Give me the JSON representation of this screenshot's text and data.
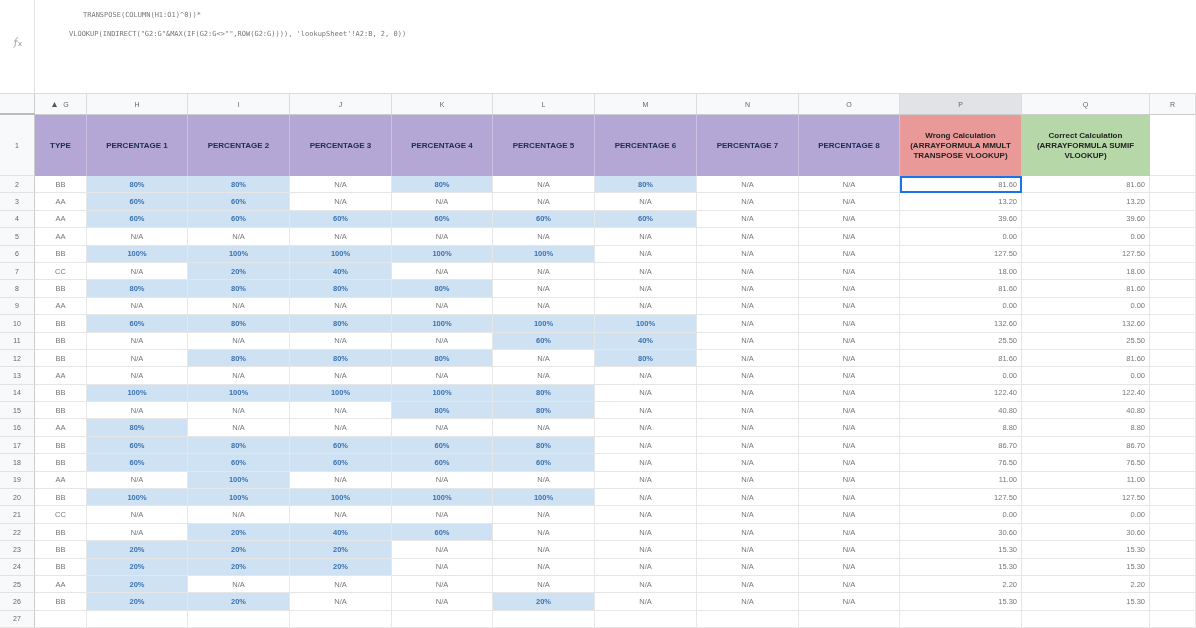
{
  "formula_bar": {
    "lines": [
      "TRANSPOSE(COLUMN(H1:O1)^0))*",
      "VLOOKUP(INDIRECT(\"G2:G\"&MAX(IF(G2:G<>\"\",ROW(G2:G)))), 'lookupSheet'!A2:B, 2, 0))"
    ]
  },
  "column_letters": [
    {
      "label": "G",
      "selected": false
    },
    {
      "label": "H",
      "selected": false
    },
    {
      "label": "I",
      "selected": false
    },
    {
      "label": "J",
      "selected": false
    },
    {
      "label": "K",
      "selected": false
    },
    {
      "label": "L",
      "selected": false
    },
    {
      "label": "M",
      "selected": false
    },
    {
      "label": "N",
      "selected": false
    },
    {
      "label": "O",
      "selected": false
    },
    {
      "label": "P",
      "selected": true
    },
    {
      "label": "Q",
      "selected": false
    },
    {
      "label": "R",
      "selected": false
    }
  ],
  "header_row": {
    "number": "1",
    "cells": [
      {
        "text": "TYPE",
        "color": "#b4a7d6"
      },
      {
        "text": "PERCENTAGE 1",
        "color": "#b4a7d6"
      },
      {
        "text": "PERCENTAGE 2",
        "color": "#b4a7d6"
      },
      {
        "text": "PERCENTAGE 3",
        "color": "#b4a7d6"
      },
      {
        "text": "PERCENTAGE 4",
        "color": "#b4a7d6"
      },
      {
        "text": "PERCENTAGE 5",
        "color": "#b4a7d6"
      },
      {
        "text": "PERCENTAGE 6",
        "color": "#b4a7d6"
      },
      {
        "text": "PERCENTAGE 7",
        "color": "#b4a7d6"
      },
      {
        "text": "PERCENTAGE 8",
        "color": "#b4a7d6"
      },
      {
        "text": "Wrong Calculation (ARRAYFORMULA MMULT TRANSPOSE VLOOKUP)",
        "color": "#ea9999"
      },
      {
        "text": "Correct Calculation (ARRAYFORMULA SUMIF VLOOKUP)",
        "color": "#b6d7a8"
      }
    ]
  },
  "rows": [
    {
      "number": "2",
      "type": "BB",
      "percentages": [
        "80%",
        "80%",
        "N/A",
        "80%",
        "N/A",
        "80%",
        "N/A",
        "N/A"
      ],
      "highlighted": [
        true,
        true,
        false,
        true,
        false,
        true,
        false,
        false
      ],
      "wrong": "81.60",
      "correct": "81.60",
      "wrong_selected": true
    },
    {
      "number": "3",
      "type": "AA",
      "percentages": [
        "60%",
        "60%",
        "N/A",
        "N/A",
        "N/A",
        "N/A",
        "N/A",
        "N/A"
      ],
      "highlighted": [
        true,
        true,
        false,
        false,
        false,
        false,
        false,
        false
      ],
      "wrong": "13.20",
      "correct": "13.20",
      "wrong_selected": false
    },
    {
      "number": "4",
      "type": "AA",
      "percentages": [
        "60%",
        "60%",
        "60%",
        "60%",
        "60%",
        "60%",
        "N/A",
        "N/A"
      ],
      "highlighted": [
        true,
        true,
        true,
        true,
        true,
        true,
        false,
        false
      ],
      "wrong": "39.60",
      "correct": "39.60",
      "wrong_selected": false
    },
    {
      "number": "5",
      "type": "AA",
      "percentages": [
        "N/A",
        "N/A",
        "N/A",
        "N/A",
        "N/A",
        "N/A",
        "N/A",
        "N/A"
      ],
      "highlighted": [
        false,
        false,
        false,
        false,
        false,
        false,
        false,
        false
      ],
      "wrong": "0.00",
      "correct": "0.00",
      "wrong_selected": false
    },
    {
      "number": "6",
      "type": "BB",
      "percentages": [
        "100%",
        "100%",
        "100%",
        "100%",
        "100%",
        "N/A",
        "N/A",
        "N/A"
      ],
      "highlighted": [
        true,
        true,
        true,
        true,
        true,
        false,
        false,
        false
      ],
      "wrong": "127.50",
      "correct": "127.50",
      "wrong_selected": false
    },
    {
      "number": "7",
      "type": "CC",
      "percentages": [
        "N/A",
        "20%",
        "40%",
        "N/A",
        "N/A",
        "N/A",
        "N/A",
        "N/A"
      ],
      "highlighted": [
        false,
        true,
        true,
        false,
        false,
        false,
        false,
        false
      ],
      "wrong": "18.00",
      "correct": "18.00",
      "wrong_selected": false
    },
    {
      "number": "8",
      "type": "BB",
      "percentages": [
        "80%",
        "80%",
        "80%",
        "80%",
        "N/A",
        "N/A",
        "N/A",
        "N/A"
      ],
      "highlighted": [
        true,
        true,
        true,
        true,
        false,
        false,
        false,
        false
      ],
      "wrong": "81.60",
      "correct": "81.60",
      "wrong_selected": false
    },
    {
      "number": "9",
      "type": "AA",
      "percentages": [
        "N/A",
        "N/A",
        "N/A",
        "N/A",
        "N/A",
        "N/A",
        "N/A",
        "N/A"
      ],
      "highlighted": [
        false,
        false,
        false,
        false,
        false,
        false,
        false,
        false
      ],
      "wrong": "0.00",
      "correct": "0.00",
      "wrong_selected": false
    },
    {
      "number": "10",
      "type": "BB",
      "percentages": [
        "60%",
        "80%",
        "80%",
        "100%",
        "100%",
        "100%",
        "N/A",
        "N/A"
      ],
      "highlighted": [
        true,
        true,
        true,
        true,
        true,
        true,
        false,
        false
      ],
      "wrong": "132.60",
      "correct": "132.60",
      "wrong_selected": false
    },
    {
      "number": "11",
      "type": "BB",
      "percentages": [
        "N/A",
        "N/A",
        "N/A",
        "N/A",
        "60%",
        "40%",
        "N/A",
        "N/A"
      ],
      "highlighted": [
        false,
        false,
        false,
        false,
        true,
        true,
        false,
        false
      ],
      "wrong": "25.50",
      "correct": "25.50",
      "wrong_selected": false
    },
    {
      "number": "12",
      "type": "BB",
      "percentages": [
        "N/A",
        "80%",
        "80%",
        "80%",
        "N/A",
        "80%",
        "N/A",
        "N/A"
      ],
      "highlighted": [
        false,
        true,
        true,
        true,
        false,
        true,
        false,
        false
      ],
      "wrong": "81.60",
      "correct": "81.60",
      "wrong_selected": false
    },
    {
      "number": "13",
      "type": "AA",
      "percentages": [
        "N/A",
        "N/A",
        "N/A",
        "N/A",
        "N/A",
        "N/A",
        "N/A",
        "N/A"
      ],
      "highlighted": [
        false,
        false,
        false,
        false,
        false,
        false,
        false,
        false
      ],
      "wrong": "0.00",
      "correct": "0.00",
      "wrong_selected": false
    },
    {
      "number": "14",
      "type": "BB",
      "percentages": [
        "100%",
        "100%",
        "100%",
        "100%",
        "80%",
        "N/A",
        "N/A",
        "N/A"
      ],
      "highlighted": [
        true,
        true,
        true,
        true,
        true,
        false,
        false,
        false
      ],
      "wrong": "122.40",
      "correct": "122.40",
      "wrong_selected": false
    },
    {
      "number": "15",
      "type": "BB",
      "percentages": [
        "N/A",
        "N/A",
        "N/A",
        "80%",
        "80%",
        "N/A",
        "N/A",
        "N/A"
      ],
      "highlighted": [
        false,
        false,
        false,
        true,
        true,
        false,
        false,
        false
      ],
      "wrong": "40.80",
      "correct": "40.80",
      "wrong_selected": false
    },
    {
      "number": "16",
      "type": "AA",
      "percentages": [
        "80%",
        "N/A",
        "N/A",
        "N/A",
        "N/A",
        "N/A",
        "N/A",
        "N/A"
      ],
      "highlighted": [
        true,
        false,
        false,
        false,
        false,
        false,
        false,
        false
      ],
      "wrong": "8.80",
      "correct": "8.80",
      "wrong_selected": false
    },
    {
      "number": "17",
      "type": "BB",
      "percentages": [
        "60%",
        "80%",
        "60%",
        "60%",
        "80%",
        "N/A",
        "N/A",
        "N/A"
      ],
      "highlighted": [
        true,
        true,
        true,
        true,
        true,
        false,
        false,
        false
      ],
      "wrong": "86.70",
      "correct": "86.70",
      "wrong_selected": false
    },
    {
      "number": "18",
      "type": "BB",
      "percentages": [
        "60%",
        "60%",
        "60%",
        "60%",
        "60%",
        "N/A",
        "N/A",
        "N/A"
      ],
      "highlighted": [
        true,
        true,
        true,
        true,
        true,
        false,
        false,
        false
      ],
      "wrong": "76.50",
      "correct": "76.50",
      "wrong_selected": false
    },
    {
      "number": "19",
      "type": "AA",
      "percentages": [
        "N/A",
        "100%",
        "N/A",
        "N/A",
        "N/A",
        "N/A",
        "N/A",
        "N/A"
      ],
      "highlighted": [
        false,
        true,
        false,
        false,
        false,
        false,
        false,
        false
      ],
      "wrong": "11.00",
      "correct": "11.00",
      "wrong_selected": false
    },
    {
      "number": "20",
      "type": "BB",
      "percentages": [
        "100%",
        "100%",
        "100%",
        "100%",
        "100%",
        "N/A",
        "N/A",
        "N/A"
      ],
      "highlighted": [
        true,
        true,
        true,
        true,
        true,
        false,
        false,
        false
      ],
      "wrong": "127.50",
      "correct": "127.50",
      "wrong_selected": false
    },
    {
      "number": "21",
      "type": "CC",
      "percentages": [
        "N/A",
        "N/A",
        "N/A",
        "N/A",
        "N/A",
        "N/A",
        "N/A",
        "N/A"
      ],
      "highlighted": [
        false,
        false,
        false,
        false,
        false,
        false,
        false,
        false
      ],
      "wrong": "0.00",
      "correct": "0.00",
      "wrong_selected": false
    },
    {
      "number": "22",
      "type": "BB",
      "percentages": [
        "N/A",
        "20%",
        "40%",
        "60%",
        "N/A",
        "N/A",
        "N/A",
        "N/A"
      ],
      "highlighted": [
        false,
        true,
        true,
        true,
        false,
        false,
        false,
        false
      ],
      "wrong": "30.60",
      "correct": "30.60",
      "wrong_selected": false
    },
    {
      "number": "23",
      "type": "BB",
      "percentages": [
        "20%",
        "20%",
        "20%",
        "N/A",
        "N/A",
        "N/A",
        "N/A",
        "N/A"
      ],
      "highlighted": [
        true,
        true,
        true,
        false,
        false,
        false,
        false,
        false
      ],
      "wrong": "15.30",
      "correct": "15.30",
      "wrong_selected": false
    },
    {
      "number": "24",
      "type": "BB",
      "percentages": [
        "20%",
        "20%",
        "20%",
        "N/A",
        "N/A",
        "N/A",
        "N/A",
        "N/A"
      ],
      "highlighted": [
        true,
        true,
        true,
        false,
        false,
        false,
        false,
        false
      ],
      "wrong": "15.30",
      "correct": "15.30",
      "wrong_selected": false
    },
    {
      "number": "25",
      "type": "AA",
      "percentages": [
        "20%",
        "N/A",
        "N/A",
        "N/A",
        "N/A",
        "N/A",
        "N/A",
        "N/A"
      ],
      "highlighted": [
        true,
        false,
        false,
        false,
        false,
        false,
        false,
        false
      ],
      "wrong": "2.20",
      "correct": "2.20",
      "wrong_selected": false
    },
    {
      "number": "26",
      "type": "BB",
      "percentages": [
        "20%",
        "20%",
        "N/A",
        "N/A",
        "20%",
        "N/A",
        "N/A",
        "N/A"
      ],
      "highlighted": [
        true,
        true,
        false,
        false,
        true,
        false,
        false,
        false
      ],
      "wrong": "15.30",
      "correct": "15.30",
      "wrong_selected": false
    }
  ],
  "empty_row": {
    "number": "27"
  }
}
